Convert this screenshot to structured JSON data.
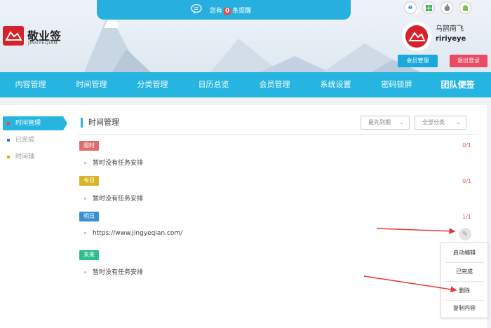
{
  "notice": {
    "prefix": "您有",
    "count": "0",
    "suffix": "条提醒"
  },
  "brand": {
    "name": "敬业签",
    "sub": "JINGYEQIAN"
  },
  "os_icons": [
    "ie-icon",
    "windows-icon",
    "apple-icon",
    "android-icon"
  ],
  "user": {
    "name": "乌鹊南飞",
    "id": "ririyeye",
    "member_btn": "会员管理",
    "logout_btn": "退出登录"
  },
  "nav": [
    "内容管理",
    "时间管理",
    "分类管理",
    "日历总览",
    "会员管理",
    "系统设置",
    "密码锁屏",
    "团队便签"
  ],
  "sidebar": [
    {
      "label": "时间管理",
      "color": "#e74c3c"
    },
    {
      "label": "已完成",
      "color": "#3c6df0"
    },
    {
      "label": "时间轴",
      "color": "#f0a020"
    }
  ],
  "main": {
    "title": "时间管理",
    "sort_select": "最先到期",
    "category_select": "全部分类"
  },
  "groups": [
    {
      "tag": "超时",
      "color": "#e06b6b",
      "count": "0/1",
      "task": "暂时没有任务安排"
    },
    {
      "tag": "今日",
      "color": "#d9b42b",
      "count": "0/1",
      "task": "暂时没有任务安排"
    },
    {
      "tag": "明日",
      "color": "#3a8fd4",
      "count": "1/1",
      "task": "https://www.jingyeqian.com/"
    },
    {
      "tag": "未来",
      "color": "#2fbf8f",
      "count": "",
      "task": "暂时没有任务安排"
    }
  ],
  "menu": [
    "启动编辑",
    "已完成",
    "删除",
    "复制内容"
  ],
  "colors": {
    "accent": "#26b5e0",
    "logout": "#ec4a63",
    "brand_red": "#d8222a"
  }
}
